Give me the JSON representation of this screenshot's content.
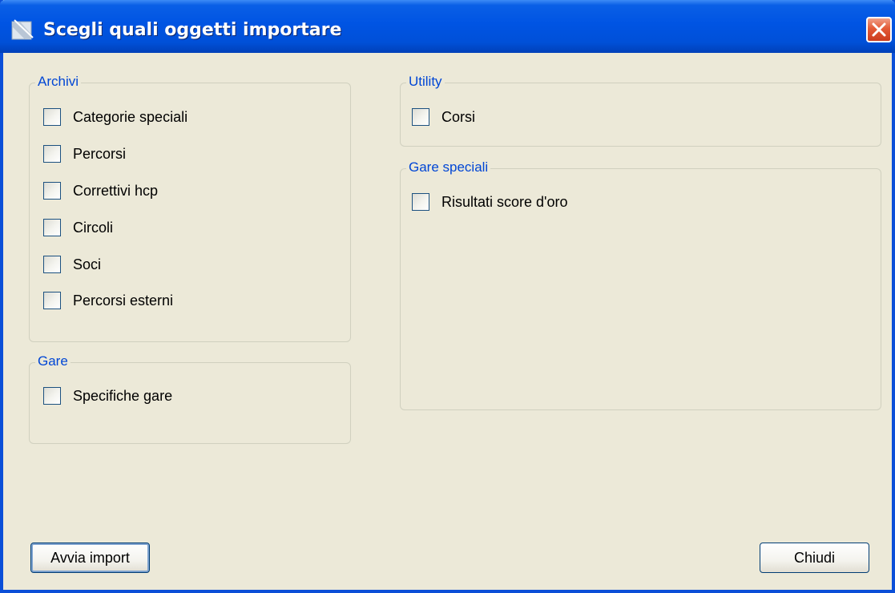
{
  "window": {
    "title": "Scegli quali oggetti importare",
    "icon": "app-icon",
    "close_icon": "close-icon",
    "accent_color": "#0054e3",
    "close_color": "#e35a36"
  },
  "groups": {
    "archivi": {
      "title": "Archivi",
      "items": [
        "Categorie speciali",
        "Percorsi",
        "Correttivi hcp",
        "Circoli",
        "Soci",
        "Percorsi esterni"
      ]
    },
    "gare": {
      "title": "Gare",
      "items": [
        "Specifiche gare"
      ]
    },
    "utility": {
      "title": "Utility",
      "items": [
        "Corsi"
      ]
    },
    "gare_speciali": {
      "title": "Gare speciali",
      "items": [
        "Risultati score d'oro"
      ]
    }
  },
  "buttons": {
    "import_label": "Avvia import",
    "close_label": "Chiudi"
  }
}
